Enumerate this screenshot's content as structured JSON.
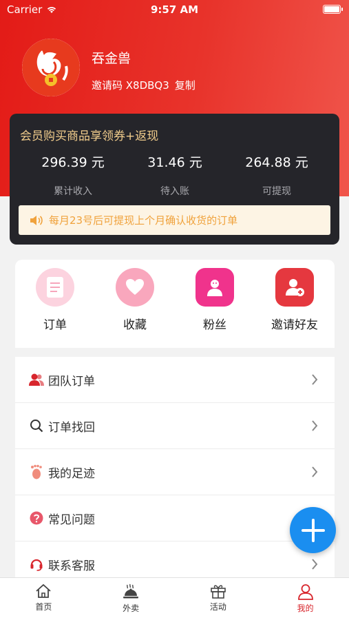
{
  "status_bar": {
    "carrier": "Carrier",
    "time": "9:57 AM"
  },
  "profile": {
    "name": "吞金兽",
    "invite_label": "邀请码 X8DBQ3",
    "copy_label": "复制"
  },
  "earnings": {
    "title": "会员购买商品享领券+返现",
    "stats": [
      {
        "value": "296.39 元",
        "label": "累计收入"
      },
      {
        "value": "31.46 元",
        "label": "待入账"
      },
      {
        "value": "264.88 元",
        "label": "可提现"
      }
    ],
    "notice": "每月23号后可提现上个月确认收货的订单"
  },
  "quick_actions": [
    {
      "label": "订单",
      "icon": "order-icon"
    },
    {
      "label": "收藏",
      "icon": "heart-icon"
    },
    {
      "label": "粉丝",
      "icon": "fans-icon"
    },
    {
      "label": "邀请好友",
      "icon": "invite-friend-icon"
    }
  ],
  "menu": [
    {
      "label": "团队订单",
      "icon": "team-icon"
    },
    {
      "label": "订单找回",
      "icon": "search-icon"
    },
    {
      "label": "我的足迹",
      "icon": "footprint-icon"
    },
    {
      "label": "常见问题",
      "icon": "question-icon"
    },
    {
      "label": "联系客服",
      "icon": "headset-icon"
    }
  ],
  "tabs": [
    {
      "label": "首页",
      "icon": "home-icon"
    },
    {
      "label": "外卖",
      "icon": "cloche-icon"
    },
    {
      "label": "活动",
      "icon": "gift-icon"
    },
    {
      "label": "我的",
      "icon": "user-icon",
      "active": true
    }
  ],
  "colors": {
    "brand_red": "#e31b17",
    "card_dark": "#25252a",
    "gold": "#f2cd8c",
    "fab_blue": "#1a8ef0",
    "active_tab": "#d8262d"
  }
}
